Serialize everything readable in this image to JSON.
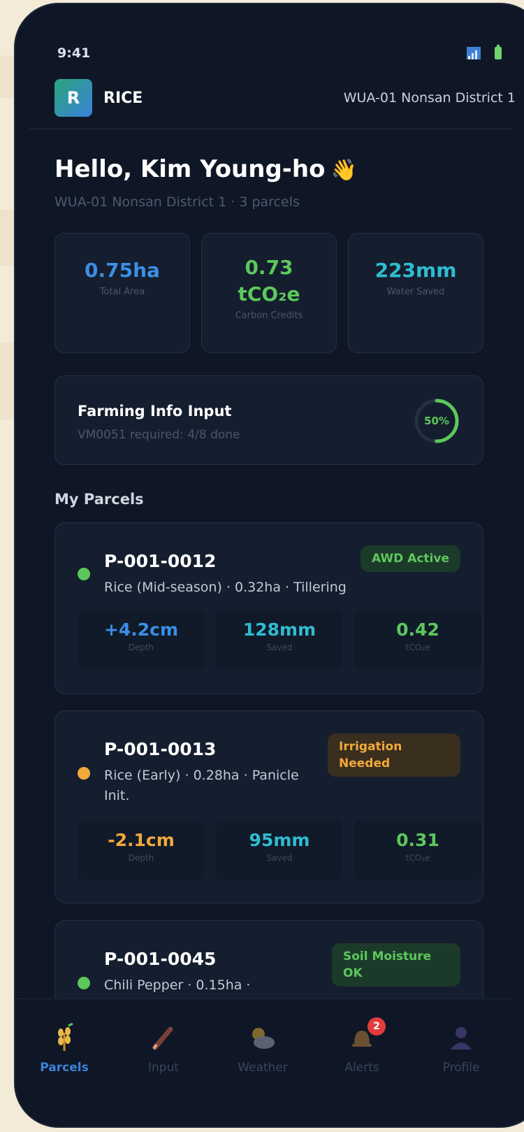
{
  "status": {
    "time": "9:41"
  },
  "header": {
    "logo_letter": "R",
    "brand": "RICE",
    "district": "WUA-01 Nonsan District 1"
  },
  "greeting": {
    "title": "Hello, Kim Young-ho",
    "wave": "👋",
    "subtitle": "WUA-01 Nonsan District 1 · 3 parcels"
  },
  "stats": [
    {
      "value": "0.75ha",
      "label": "Total Area",
      "color": "#3b8fe6"
    },
    {
      "value_line1": "0.73",
      "value_line2": "tCO₂e",
      "label": "Carbon Credits",
      "color": "#5cc85c"
    },
    {
      "value": "223mm",
      "label": "Water Saved",
      "color": "#2fbcd0"
    }
  ],
  "farming_info": {
    "title": "Farming Info Input",
    "subtitle": "VM0051 required: 4/8 done",
    "progress_label": "50%",
    "progress": 0.5
  },
  "section_title": "My Parcels",
  "parcels": [
    {
      "id": "P-001-0012",
      "desc": "Rice (Mid-season) · 0.32ha · Tillering",
      "status_color": "#5cc85c",
      "badge": "AWD Active",
      "metrics": [
        {
          "value": "+4.2cm",
          "label": "Depth",
          "color": "#3b8fe6"
        },
        {
          "value": "128mm",
          "label": "Saved",
          "color": "#2fbcd0"
        },
        {
          "value": "0.42",
          "label": "tCO₂e",
          "color": "#5cc85c"
        }
      ]
    },
    {
      "id": "P-001-0013",
      "desc": "Rice (Early) · 0.28ha · Panicle Init.",
      "status_color": "#f2a93b",
      "badge": "Irrigation Needed",
      "metrics": [
        {
          "value": "-2.1cm",
          "label": "Depth",
          "color": "#f2a93b"
        },
        {
          "value": "95mm",
          "label": "Saved",
          "color": "#2fbcd0"
        },
        {
          "value": "0.31",
          "label": "tCO₂e",
          "color": "#5cc85c"
        }
      ]
    },
    {
      "id": "P-001-0045",
      "desc": "Chili Pepper · 0.15ha ·",
      "status_color": "#5cc85c",
      "badge": "Soil Moisture OK"
    }
  ],
  "nav": [
    {
      "label": "Parcels",
      "icon": "wheat-icon"
    },
    {
      "label": "Input",
      "icon": "pencil-icon"
    },
    {
      "label": "Weather",
      "icon": "cloud-sun-icon"
    },
    {
      "label": "Alerts",
      "icon": "bell-icon",
      "badge": "2"
    },
    {
      "label": "Profile",
      "icon": "user-icon"
    }
  ]
}
